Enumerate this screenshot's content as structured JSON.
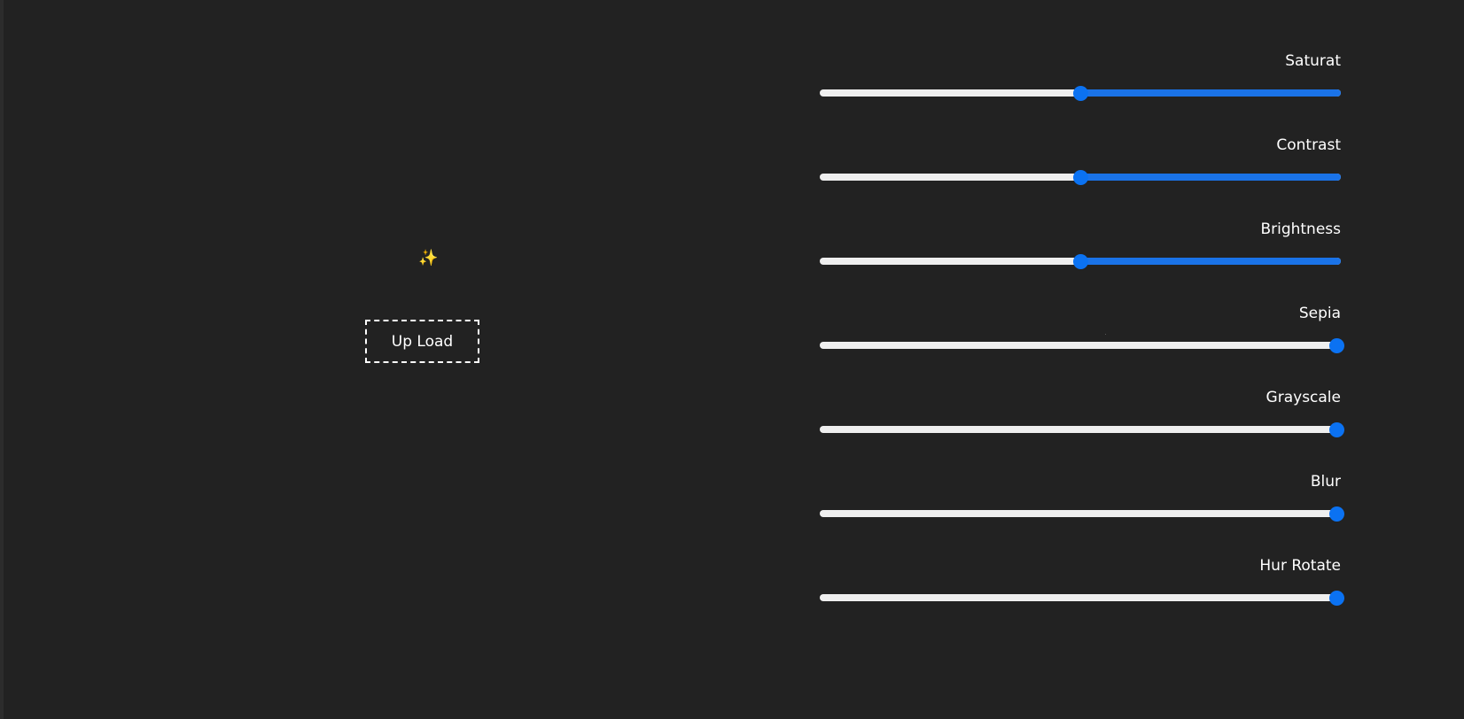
{
  "upload": {
    "label": "Up Load",
    "icon": "sparkles-icon",
    "icon_glyph": "✨"
  },
  "filters": [
    {
      "label": "Saturat",
      "value": 0.5
    },
    {
      "label": "Contrast",
      "value": 0.5
    },
    {
      "label": "Brightness",
      "value": 0.5
    },
    {
      "label": "Sepia",
      "value": 1.0
    },
    {
      "label": "Grayscale",
      "value": 1.0
    },
    {
      "label": "Blur",
      "value": 1.0
    },
    {
      "label": "Hur Rotate",
      "value": 1.0
    }
  ],
  "colors": {
    "background": "#222222",
    "accent": "#0b72f2",
    "track": "#efefef",
    "sparkle": "#f3d36b"
  }
}
